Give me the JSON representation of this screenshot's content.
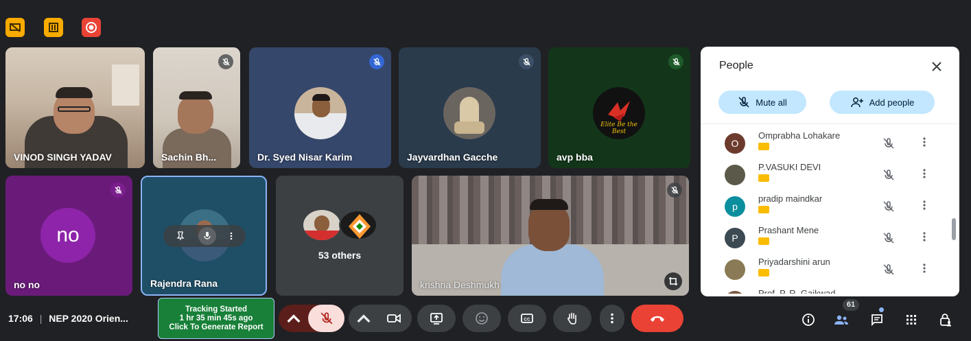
{
  "meeting": {
    "time": "17:06",
    "separator": "|",
    "title": "NEP 2020 Orien..."
  },
  "tracking": {
    "line1": "Tracking Started",
    "line2": "1 hr 35 min 45s ago",
    "line3": "Click To Generate Report"
  },
  "tiles": {
    "vinod": "VINOD SINGH YADAV",
    "sachin": "Sachin Bh...",
    "syed": "Dr. Syed Nisar Karim",
    "jayvardhan": "Jayvardhan Gacche",
    "avp": "avp bba",
    "avp_logo_text": "Elite Be the Best",
    "nono_initials": "no",
    "nono": "no no",
    "rajendra": "Rajendra Rana",
    "others": "53 others",
    "krishna": "krishna Deshmukh"
  },
  "people_panel": {
    "title": "People",
    "mute_all": "Mute all",
    "add_people": "Add people",
    "participants": [
      {
        "name": "Omprabha Lohakare",
        "initial": "O",
        "color": "#6d3b2e"
      },
      {
        "name": "P.VASUKI DEVI",
        "initial": "",
        "color": "#5b5a4a"
      },
      {
        "name": "pradip maindkar",
        "initial": "p",
        "color": "#0b8f9e"
      },
      {
        "name": "Prashant Mene",
        "initial": "P",
        "color": "#3c4a53"
      },
      {
        "name": "Priyadarshini arun",
        "initial": "",
        "color": "#8a7a55"
      },
      {
        "name": "Prof. P. R. Gaikwad",
        "initial": "",
        "color": "#7a5a45"
      }
    ]
  },
  "badges": {
    "people_count": "61"
  },
  "colors": {
    "background": "#202124",
    "leave_red": "#ea4335",
    "pill_blue": "#c2e7ff",
    "tracking_green": "#188038",
    "purple_tile": "#6a1b7a",
    "highlight_border": "#8ab4f8"
  }
}
